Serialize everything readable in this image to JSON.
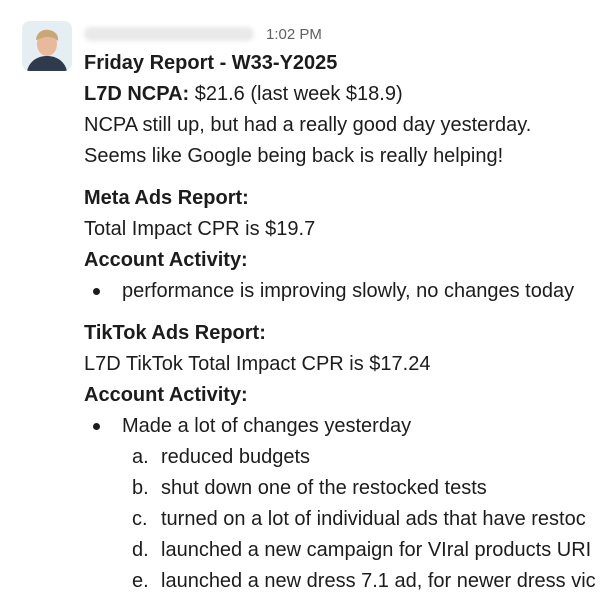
{
  "message": {
    "time": "1:02 PM",
    "title": "Friday Report - W33-Y2025",
    "ncpa_label": "L7D NCPA:",
    "ncpa_value": " $21.6 (last week $18.9)",
    "line1": "NCPA still up, but had a really good day yesterday.",
    "line2": "Seems like Google being back is really helping!",
    "meta": {
      "heading": "Meta Ads Report:",
      "cpr": "Total Impact CPR is $19.7",
      "activity_heading": "Account Activity:",
      "bullets": [
        "performance is improving slowly, no changes today"
      ]
    },
    "tiktok": {
      "heading": "TikTok Ads Report:",
      "cpr": "L7D TikTok Total Impact CPR is $17.24",
      "activity_heading": "Account Activity:",
      "bullet": "Made a lot of changes yesterday",
      "sub_items": [
        {
          "marker": "a.",
          "text": "reduced budgets"
        },
        {
          "marker": "b.",
          "text": "shut down one of the restocked tests"
        },
        {
          "marker": "c.",
          "text": "turned on a lot of individual ads that have restoc"
        },
        {
          "marker": "d.",
          "text": "launched a new campaign for VIral products URI"
        },
        {
          "marker": "e.",
          "text": "launched a new dress 7.1 ad, for newer dress vic"
        }
      ]
    }
  }
}
